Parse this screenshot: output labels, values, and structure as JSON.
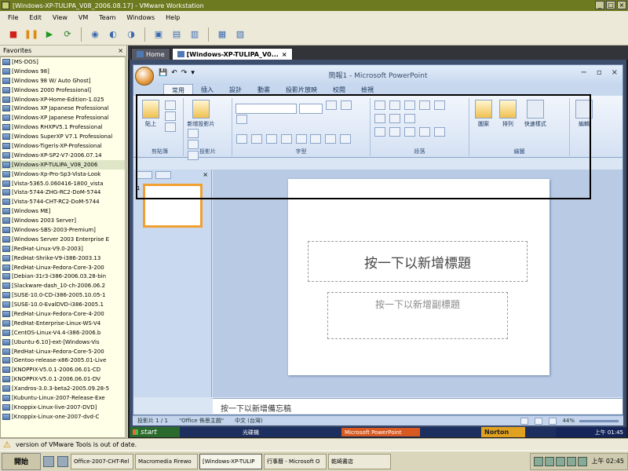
{
  "titlebar": {
    "title": "[Windows-XP-TULIPA_V08_2006.08.17] - VMware Workstation"
  },
  "menubar": [
    "File",
    "Edit",
    "View",
    "VM",
    "Team",
    "Windows",
    "Help"
  ],
  "favorites": {
    "header": "Favorites",
    "close": "×",
    "items": [
      "[MS-DOS]",
      "[Windows 98]",
      "[Windows 98 W/ Auto Ghost]",
      "[Windows 2000 Professional]",
      "[Windows-XP-Home-Edition-1.025",
      "[Windows XP Japanese Professional",
      "[Windows-XP Japanese Professional",
      "[Windows RHXPV5.1 Professional",
      "[Windows SuperXP V7.1 Professional",
      "[Windows-Tigeris-XP-Professional",
      "[Windows-XP-SP2-V7-2006.07.14",
      "[Windows-XP-TULIPA_V08_2006",
      "[Windows-Xp-Pro-Sp3-Vista-Look",
      "[Vista-5365.0.060416-1800_vista",
      "[Vista-5744-ZHG-RC2-DoM-5744",
      "[Vista-5744-CHT-RC2-DoM-5744",
      "[Windows ME]",
      "[Windows 2003 Server]",
      "[Windows-SBS-2003-Premium]",
      "[Windows Server 2003 Enterprise E",
      "[RedHat-Linux-V9.0-2003]",
      "[RedHat-Shrike-V9-i386-2003.13",
      "[RedHat-Linux-Fedora-Core-3-200",
      "[Debian-31r3-i386-2006.03.28-bin",
      "[Slackware-dash_10-ch-2006.06.2",
      "[SUSE-10.0-CD-i386-2005.10.05-1",
      "[SUSE-10.0-EvalDVD-i386-2005.1",
      "[RedHat-Linux-Fedora-Core-4-200",
      "[RedHat-Enterprise-Linux-WS-V4",
      "[CentOS-Linux-V4.4-i386-2006.b",
      "[Ubuntu-6.10]-ext-[Windows-Vis",
      "[RedHat-Linux-Fedora-Core-5-200",
      "[Gentoo-release-x86-2005.01-Live",
      "[KNOPPIX-V5.0.1-2006.06.01-CD",
      "[KNOPPIX-V5.0.1-2006.06.01-DV",
      "[Xandros-3.0.3-beta2-2005.09.28-5",
      "[Kubuntu-Linux-2007-Release-Exe",
      "[Knoppix-Linux-live-2007-DVD]",
      "[Knoppix-Linux-one-2007-dvd-C"
    ],
    "selected_index": 11
  },
  "vm_tabs": [
    {
      "label": "Home",
      "active": false
    },
    {
      "label": "[Windows-XP-TULIPA_V0...",
      "active": true
    }
  ],
  "powerpoint": {
    "title": "簡報1 - Microsoft PowerPoint",
    "window_buttons": [
      "−",
      "▫",
      "×"
    ],
    "tabs": [
      "常用",
      "插入",
      "設計",
      "動畫",
      "投影片放映",
      "校閱",
      "檢視"
    ],
    "active_tab": "常用",
    "groups": [
      {
        "label": "剪貼簿",
        "buttons": [
          "貼上"
        ]
      },
      {
        "label": "投影片",
        "buttons": [
          "新增投影片"
        ]
      },
      {
        "label": "字型",
        "buttons": []
      },
      {
        "label": "段落",
        "buttons": []
      },
      {
        "label": "繪圖",
        "buttons": [
          "圖案",
          "排列",
          "快速樣式"
        ]
      },
      {
        "label": "",
        "buttons": [
          "編輯"
        ]
      }
    ],
    "slide_title_placeholder": "按一下以新增標題",
    "slide_subtitle_placeholder": "按一下以新增副標題",
    "notes_placeholder": "按一下以新增備忘稿",
    "status": {
      "slide_count": "投影片 1 / 1",
      "theme": "\"Office 佈景主題\"",
      "language": "中文 (台灣)",
      "zoom": "44%"
    }
  },
  "guest_taskbar": {
    "start": "start",
    "tasks": [
      "光碟機",
      "Microsoft PowerPoint"
    ],
    "norton": "Norton",
    "clock": "上午 01:45"
  },
  "vm_strip": {
    "message": "version of VMware Tools is out of date."
  },
  "host_taskbar": {
    "start": "開始",
    "tasks": [
      "Office-2007-CHT-Rel",
      "Macromedia Firewo",
      "[Windows-XP-TULIP",
      "行事曆 - Microsoft O",
      "乾崎書店"
    ],
    "clock": "上午 02:45"
  },
  "colors": {
    "host_title": "#6e7a1f",
    "ribbon": "#d4e1f3",
    "guest_taskbar": "#1c2f5e",
    "norton": "#e0a020"
  }
}
